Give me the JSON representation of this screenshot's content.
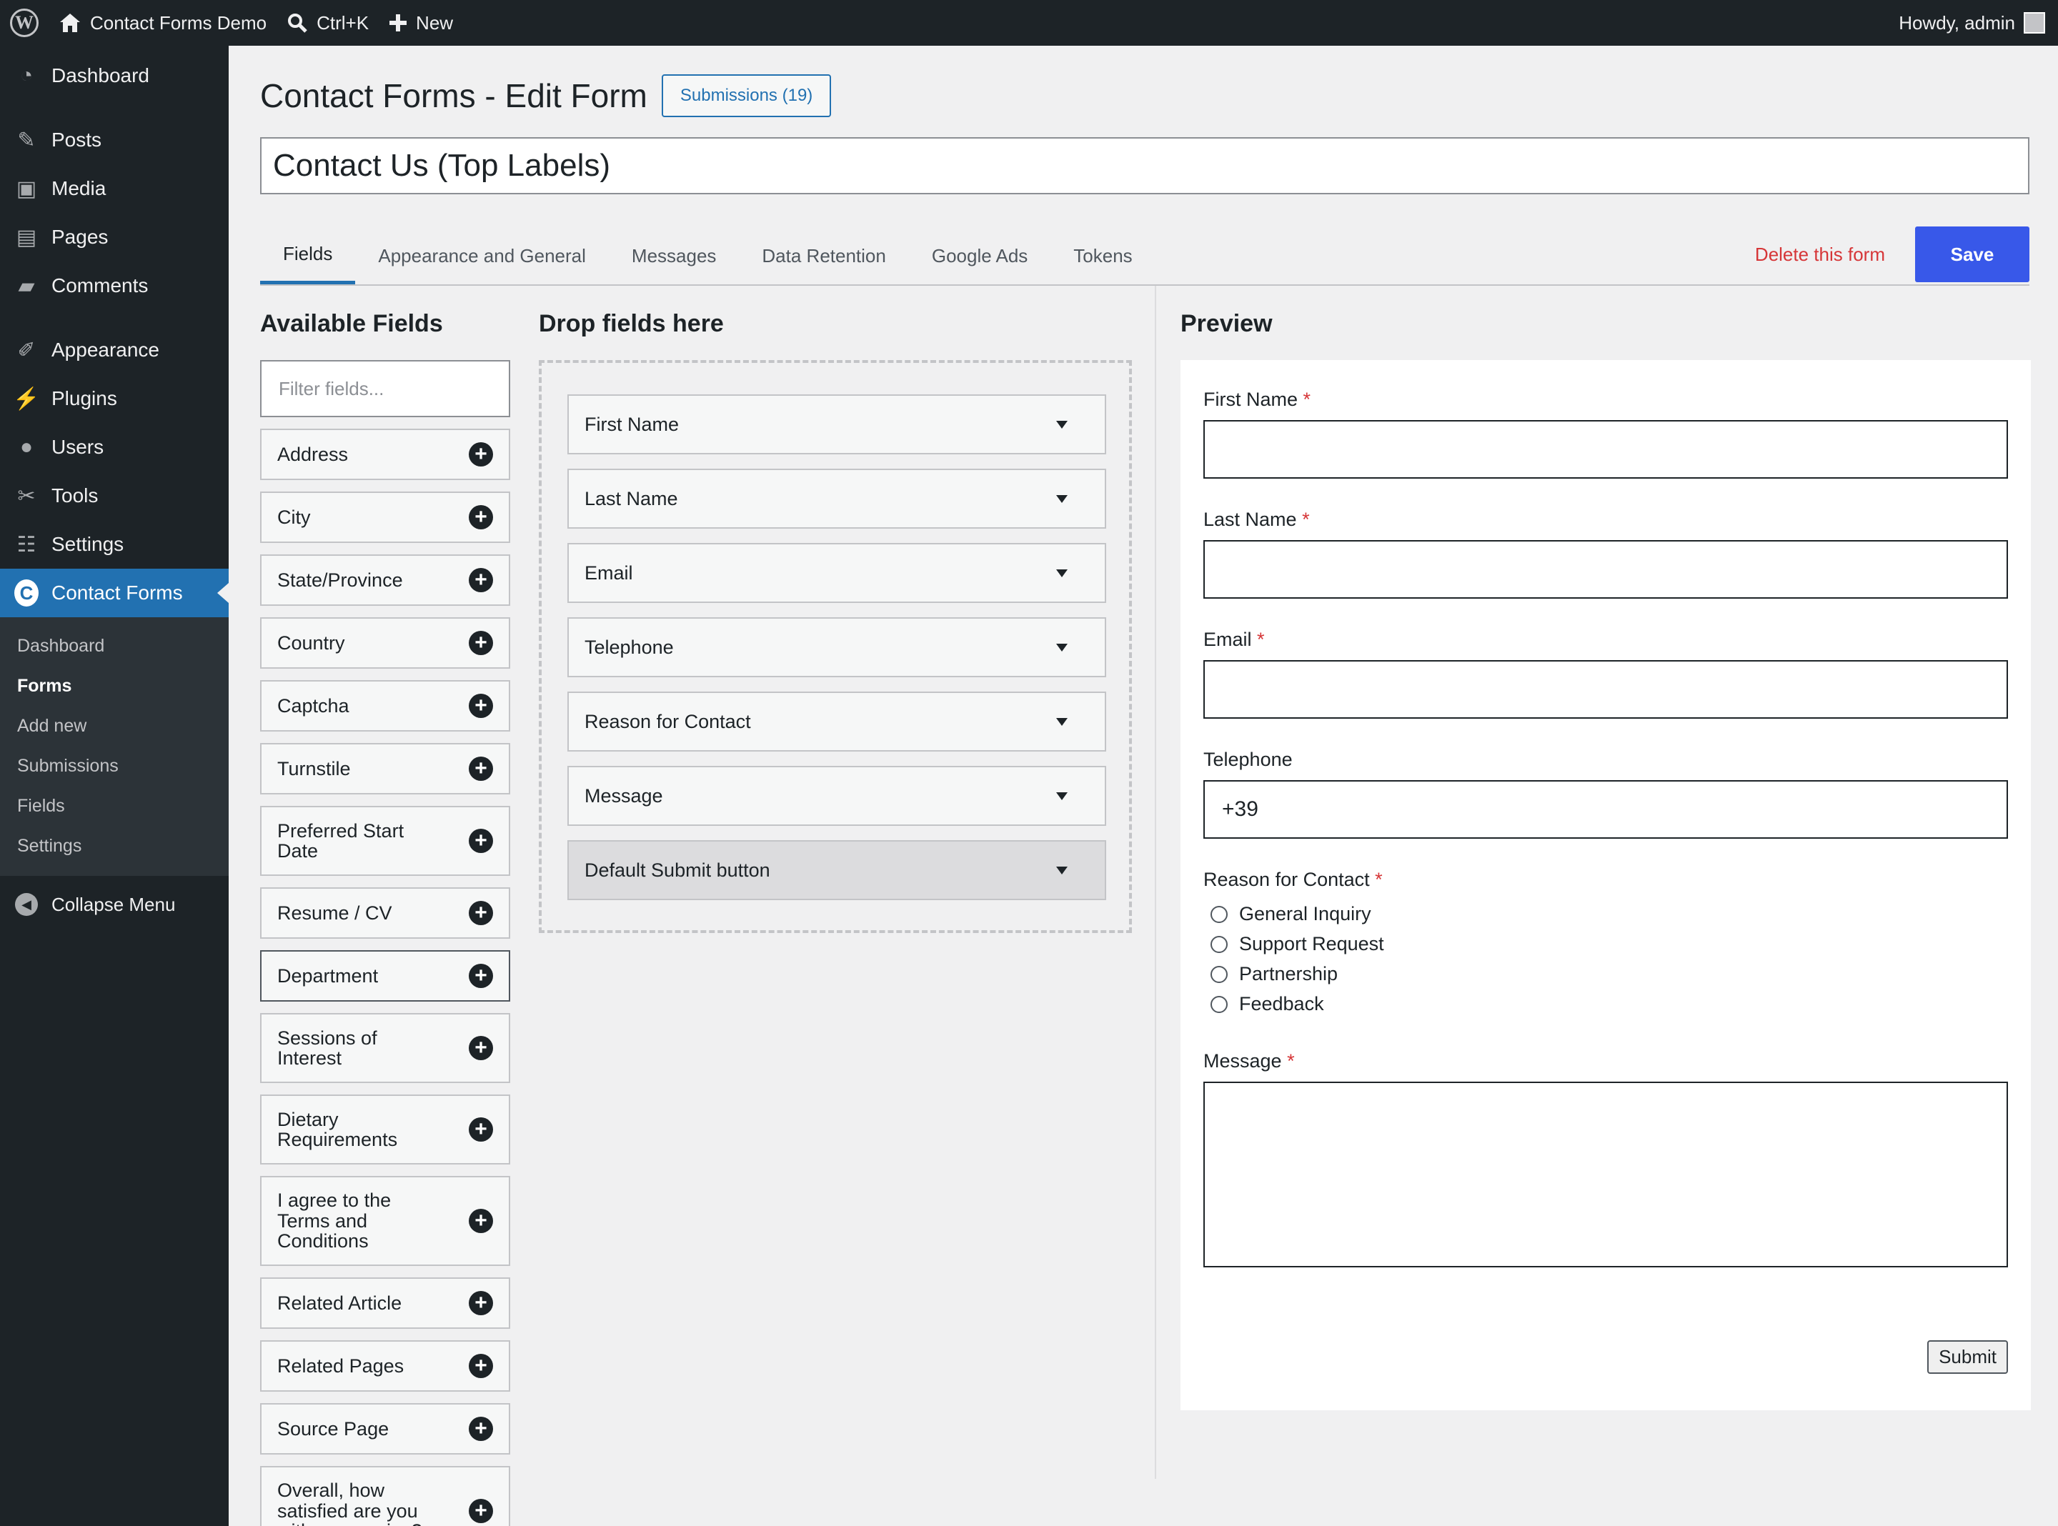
{
  "adminbar": {
    "site_name": "Contact Forms Demo",
    "search_shortcut": "Ctrl+K",
    "new_label": "New",
    "greeting": "Howdy, admin"
  },
  "sidebar": {
    "items": [
      {
        "label": "Dashboard",
        "icon": "dashboard-icon"
      },
      {
        "label": "Posts",
        "icon": "pin-icon"
      },
      {
        "label": "Media",
        "icon": "media-icon"
      },
      {
        "label": "Pages",
        "icon": "pages-icon"
      },
      {
        "label": "Comments",
        "icon": "comment-icon"
      },
      {
        "label": "Appearance",
        "icon": "brush-icon"
      },
      {
        "label": "Plugins",
        "icon": "plug-icon"
      },
      {
        "label": "Users",
        "icon": "user-icon"
      },
      {
        "label": "Tools",
        "icon": "wrench-icon"
      },
      {
        "label": "Settings",
        "icon": "sliders-icon"
      },
      {
        "label": "Contact Forms",
        "icon": "contact-forms-icon"
      }
    ],
    "submenu": [
      "Dashboard",
      "Forms",
      "Add new",
      "Submissions",
      "Fields",
      "Settings"
    ],
    "collapse_label": "Collapse Menu"
  },
  "header": {
    "title": "Contact Forms - Edit Form",
    "submissions_button": "Submissions (19)",
    "form_name": "Contact Us (Top Labels)"
  },
  "tabs": [
    "Fields",
    "Appearance and General",
    "Messages",
    "Data Retention",
    "Google Ads",
    "Tokens"
  ],
  "actions": {
    "delete_label": "Delete this form",
    "save_label": "Save"
  },
  "available": {
    "heading": "Available Fields",
    "filter_placeholder": "Filter fields...",
    "items": [
      "Address",
      "City",
      "State/Province",
      "Country",
      "Captcha",
      "Turnstile",
      "Preferred Start Date",
      "Resume / CV",
      "Department",
      "Sessions of Interest",
      "Dietary Requirements",
      "I agree to the Terms and Conditions",
      "Related Article",
      "Related Pages",
      "Source Page",
      "Overall, how satisfied are you with our service?"
    ]
  },
  "dropzone": {
    "heading": "Drop fields here",
    "items": [
      "First Name",
      "Last Name",
      "Email",
      "Telephone",
      "Reason for Contact",
      "Message",
      "Default Submit button"
    ]
  },
  "preview": {
    "heading": "Preview",
    "first_name_label": "First Name",
    "last_name_label": "Last Name",
    "email_label": "Email",
    "telephone_label": "Telephone",
    "telephone_value": "+39",
    "reason_label": "Reason for Contact",
    "reason_options": [
      "General Inquiry",
      "Support Request",
      "Partnership",
      "Feedback"
    ],
    "message_label": "Message",
    "required_mark": "*",
    "submit_label": "Submit"
  },
  "colors": {
    "accent": "#2271b1",
    "save_button": "#3858e9",
    "delete_link": "#d63638",
    "adminbar": "#1d2327"
  }
}
